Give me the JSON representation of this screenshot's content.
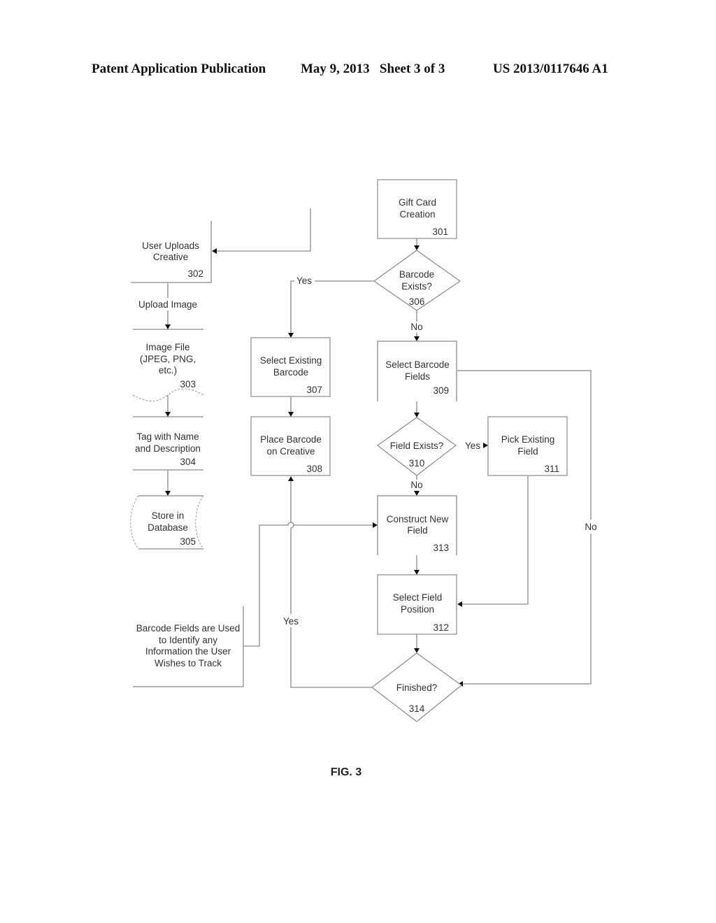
{
  "header": {
    "publication": "Patent Application Publication",
    "date_sheet": "May 9, 2013   Sheet 3 of 3",
    "number": "US 2013/0117646 A1"
  },
  "figure_label": "FIG. 3",
  "nodes": {
    "n301": {
      "lines": [
        "Gift Card",
        "Creation"
      ],
      "ref": "301",
      "shape": "process"
    },
    "n302": {
      "lines": [
        "User Uploads",
        "Creative"
      ],
      "ref": "302",
      "shape": "annotation"
    },
    "n303": {
      "lines": [
        "Image File",
        "(JPEG, PNG,",
        "etc.)"
      ],
      "ref": "303",
      "shape": "document"
    },
    "n304": {
      "lines": [
        "Tag with Name",
        "and Description"
      ],
      "ref": "304",
      "shape": "annotation"
    },
    "n305": {
      "lines": [
        "Store in",
        "Database"
      ],
      "ref": "305",
      "shape": "stored-data"
    },
    "n306": {
      "lines": [
        "Barcode",
        "Exists?"
      ],
      "ref": "306",
      "shape": "decision"
    },
    "n307": {
      "lines": [
        "Select Existing",
        "Barcode"
      ],
      "ref": "307",
      "shape": "process"
    },
    "n308": {
      "lines": [
        "Place Barcode",
        "on Creative"
      ],
      "ref": "308",
      "shape": "process"
    },
    "n309": {
      "lines": [
        "Select Barcode",
        "Fields"
      ],
      "ref": "309",
      "shape": "process"
    },
    "n310": {
      "lines": [
        "Field Exists?"
      ],
      "ref": "310",
      "shape": "decision"
    },
    "n311": {
      "lines": [
        "Pick Existing",
        "Field"
      ],
      "ref": "311",
      "shape": "process"
    },
    "n312": {
      "lines": [
        "Select Field",
        "Position"
      ],
      "ref": "312",
      "shape": "process"
    },
    "n313": {
      "lines": [
        "Construct New",
        "Field"
      ],
      "ref": "313",
      "shape": "process"
    },
    "n314": {
      "lines": [
        "Finished?"
      ],
      "ref": "314",
      "shape": "decision"
    },
    "note": {
      "lines": [
        "Barcode Fields are Used",
        "to Identify any",
        "Information the User",
        "Wishes to Track"
      ],
      "shape": "annotation"
    }
  },
  "edge_labels": {
    "upload_image": "Upload Image",
    "e306_yes": "Yes",
    "e306_no": "No",
    "e310_yes": "Yes",
    "e310_no": "No",
    "e309_no": "No",
    "e314_yes": "Yes"
  }
}
